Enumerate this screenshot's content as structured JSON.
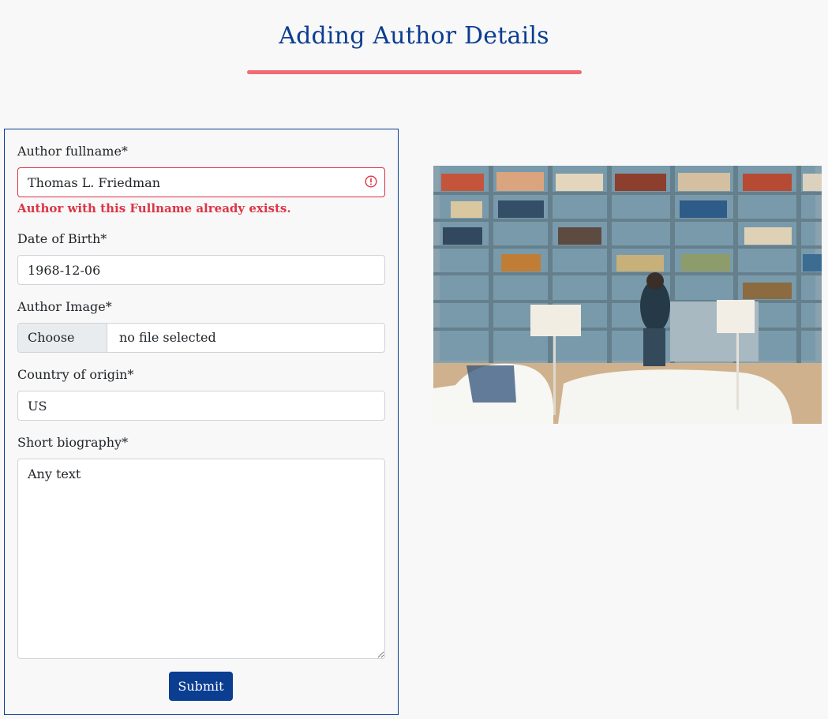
{
  "page": {
    "title": "Adding Author Details"
  },
  "form": {
    "fullname": {
      "label": "Author fullname*",
      "value": "Thomas L. Friedman",
      "error": "Author with this Fullname already exists."
    },
    "dob": {
      "label": "Date of Birth*",
      "value": "1968-12-06"
    },
    "image": {
      "label": "Author Image*",
      "button_label": "Choose File",
      "status": "no file selected"
    },
    "country": {
      "label": "Country of origin*",
      "value": "US"
    },
    "biography": {
      "label": "Short biography*",
      "value": "Any text"
    },
    "submit_label": "Submit"
  },
  "colors": {
    "primary": "#0b3d91",
    "accent": "#f06b74",
    "error": "#dc3545"
  },
  "image": {
    "subject": "library room with bookshelves and white sofas"
  }
}
